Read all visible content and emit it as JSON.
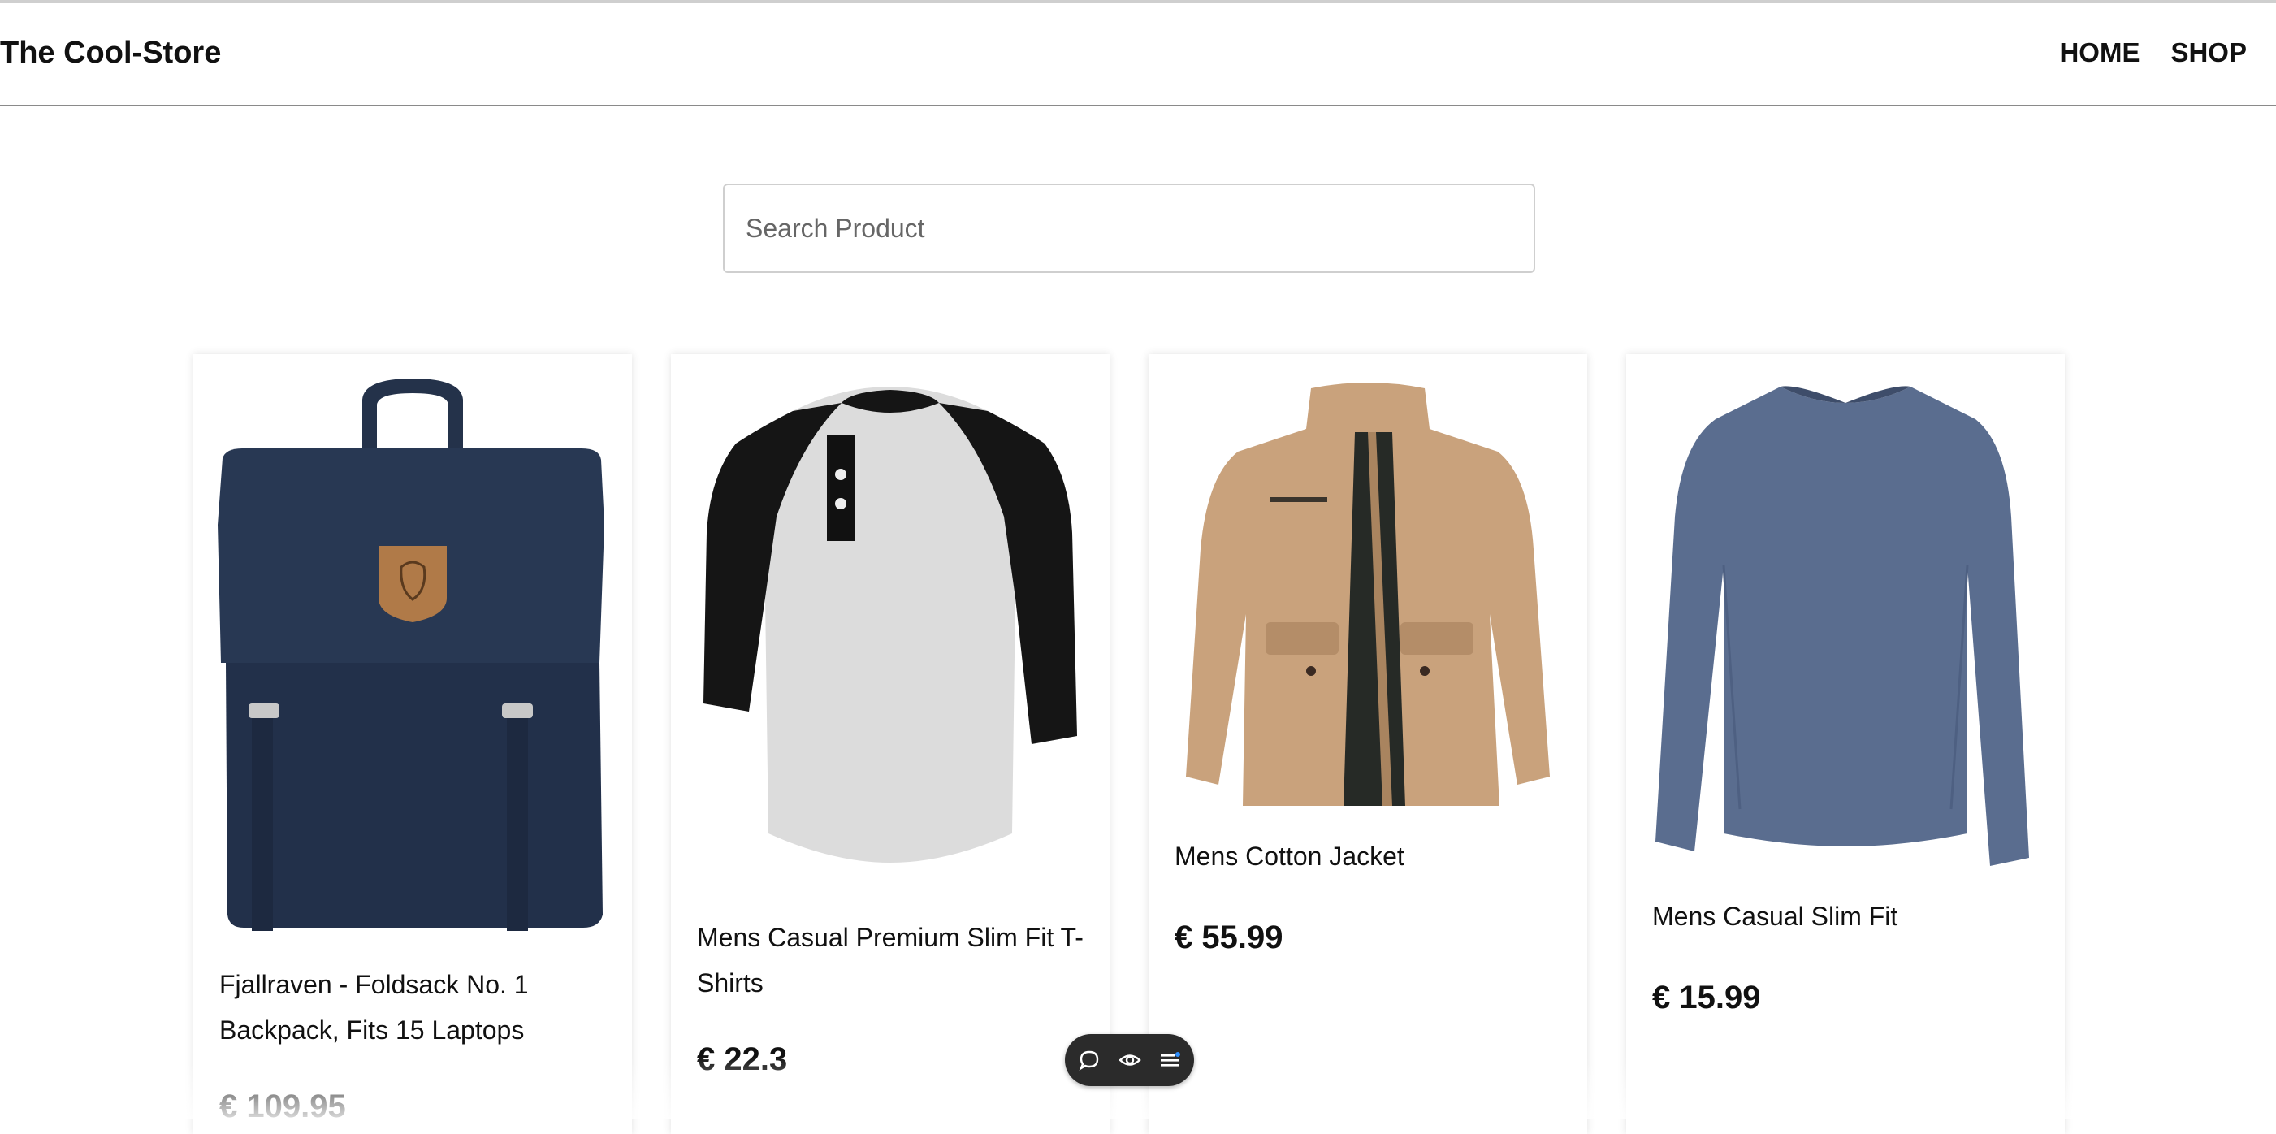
{
  "header": {
    "brand": "The Cool-Store",
    "nav": [
      {
        "label": "HOME"
      },
      {
        "label": "SHOP"
      }
    ]
  },
  "search": {
    "placeholder": "Search Product",
    "value": ""
  },
  "products": [
    {
      "title": "Fjallraven - Foldsack No. 1 Backpack, Fits 15 Laptops",
      "price": "€ 109.95"
    },
    {
      "title": "Mens Casual Premium Slim Fit T-Shirts",
      "price": "€ 22.3"
    },
    {
      "title": "Mens Cotton Jacket",
      "price": "€ 55.99"
    },
    {
      "title": "Mens Casual Slim Fit",
      "price": "€ 15.99"
    }
  ],
  "toolbar": {
    "icons": [
      "chat-icon",
      "eye-icon",
      "menu-icon"
    ]
  },
  "colors": {
    "text": "#111111",
    "divider": "#8a8a8a",
    "toolbar": "#2b2b2b",
    "backpack": "#24324a",
    "jacket": "#c9a27c",
    "shirt-blue": "#5a6d8f"
  }
}
